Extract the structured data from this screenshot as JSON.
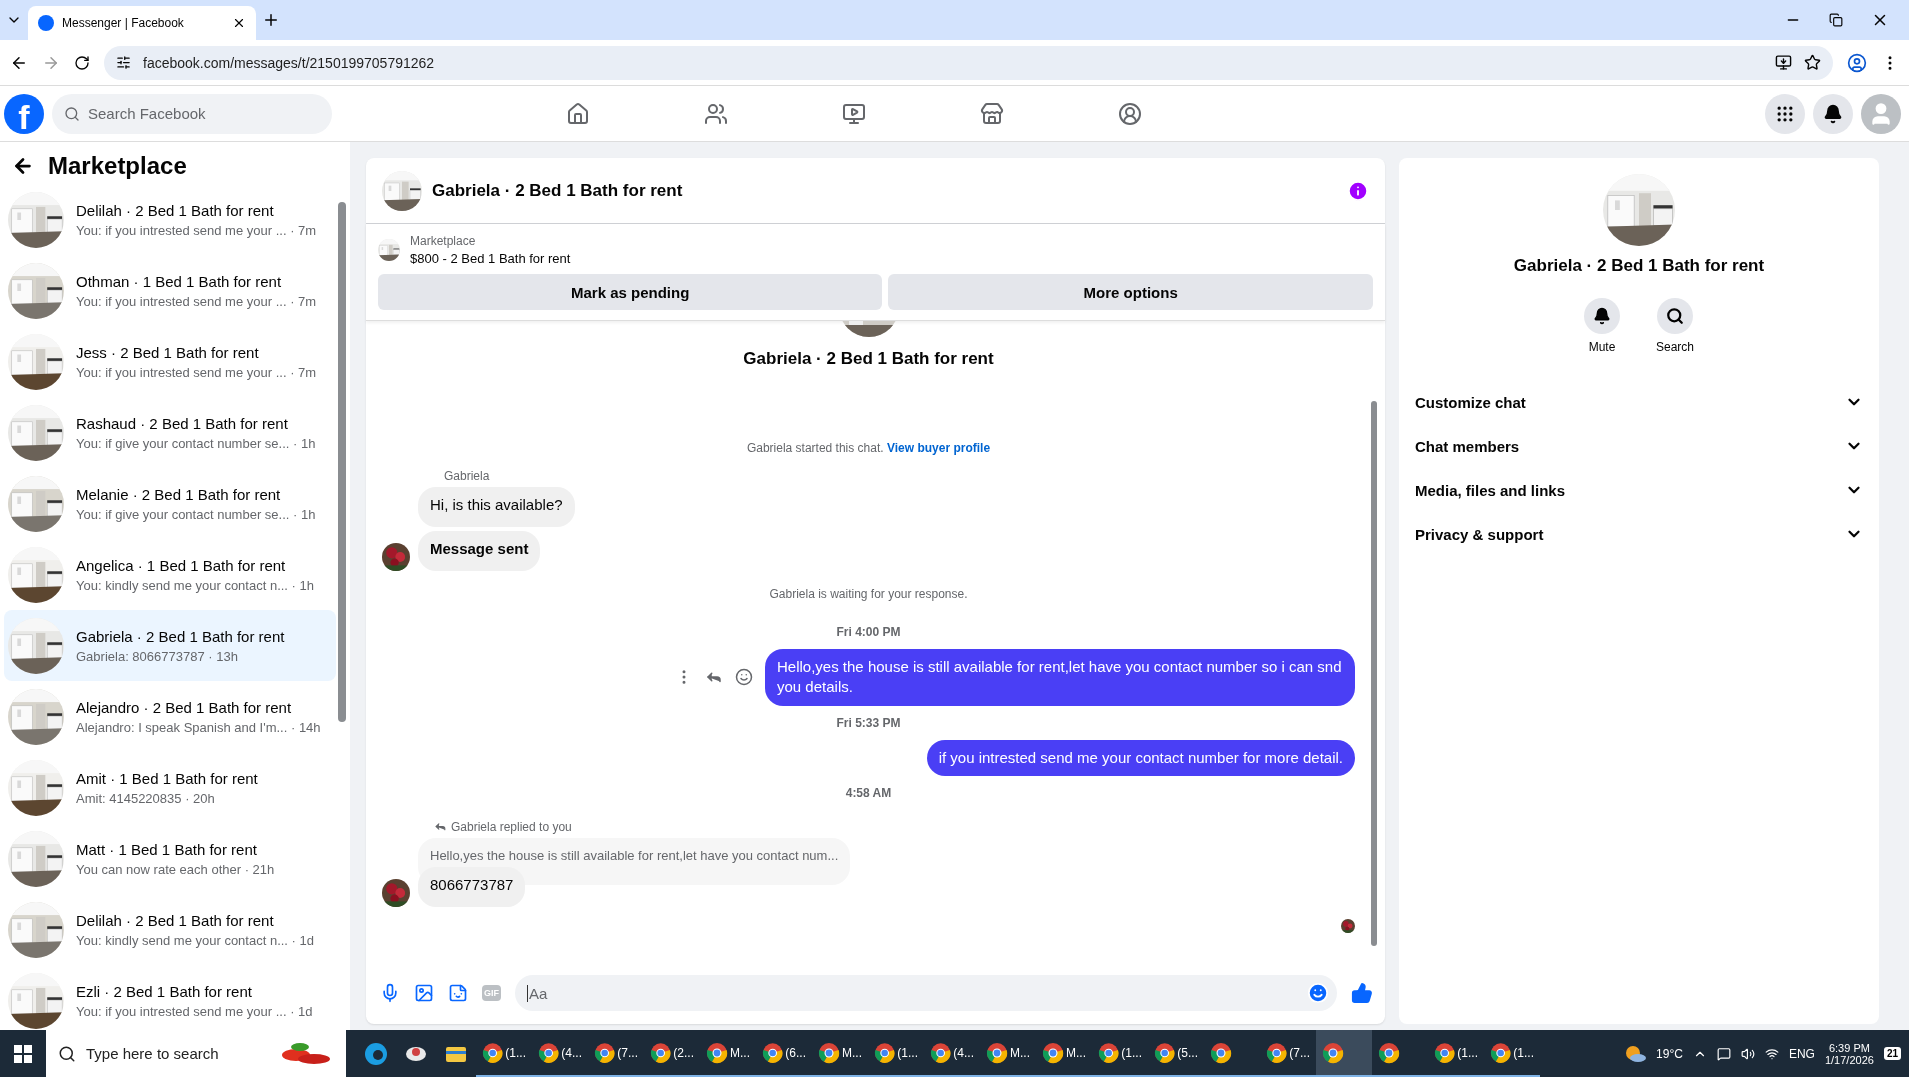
{
  "browser": {
    "tab_title": "Messenger | Facebook",
    "url": "facebook.com/messages/t/2150199705791262"
  },
  "facebook": {
    "logo_letter": "f",
    "search_placeholder": "Search Facebook"
  },
  "sidebar": {
    "title": "Marketplace",
    "conversations": [
      {
        "name": "Delilah · 2 Bed 1 Bath for rent",
        "preview": "You: if you intrested send me your ... · 7m",
        "selected": false
      },
      {
        "name": "Othman · 1 Bed 1 Bath for rent",
        "preview": "You: if you intrested send me your ... · 7m",
        "selected": false
      },
      {
        "name": "Jess · 2 Bed 1 Bath for rent",
        "preview": "You: if you intrested send me your ... · 7m",
        "selected": false
      },
      {
        "name": "Rashaud · 2 Bed 1 Bath for rent",
        "preview": "You: if give your contact number se... · 1h",
        "selected": false
      },
      {
        "name": "Melanie · 2 Bed 1 Bath for rent",
        "preview": "You: if give your contact number se... · 1h",
        "selected": false
      },
      {
        "name": "Angelica · 1 Bed 1 Bath for rent",
        "preview": "You: kindly send me your contact n... · 1h",
        "selected": false
      },
      {
        "name": "Gabriela · 2 Bed 1 Bath for rent",
        "preview": "Gabriela: 8066773787 · 13h",
        "selected": true
      },
      {
        "name": "Alejandro · 2 Bed 1 Bath for rent",
        "preview": "Alejandro: I speak Spanish and I'm... · 14h",
        "selected": false
      },
      {
        "name": "Amit · 1 Bed 1 Bath for rent",
        "preview": "Amit: 4145220835 · 20h",
        "selected": false
      },
      {
        "name": "Matt · 1 Bed 1 Bath for rent",
        "preview": "You can now rate each other · 21h",
        "selected": false
      },
      {
        "name": "Delilah · 2 Bed 1 Bath for rent",
        "preview": "You: kindly send me your contact n... · 1d",
        "selected": false
      },
      {
        "name": "Ezli · 2 Bed 1 Bath for rent",
        "preview": "You: if you intrested send me your ... · 1d",
        "selected": false
      }
    ]
  },
  "chat": {
    "title": "Gabriela · 2 Bed 1 Bath for rent",
    "listing": {
      "label": "Marketplace",
      "title": "$800 - 2 Bed 1 Bath for rent"
    },
    "actions": [
      "Mark as pending",
      "More options"
    ],
    "profile_name": "Gabriela · 2 Bed 1 Bath for rent",
    "messages": [
      {
        "kind": "system",
        "text": "Gabriela started this chat.",
        "link": "View buyer profile"
      },
      {
        "kind": "sender",
        "text": "Gabriela"
      },
      {
        "kind": "incoming",
        "text": "Hi, is this available?",
        "bold": false,
        "avatar": false
      },
      {
        "kind": "incoming",
        "text": "Message sent",
        "bold": true,
        "avatar": true
      },
      {
        "kind": "system",
        "text": "Gabriela is waiting for your response."
      },
      {
        "kind": "time",
        "text": "Fri 4:00 PM"
      },
      {
        "kind": "outgoing",
        "text": "Hello,yes the house is still available for rent,let have you contact number so i can snd you details.",
        "hover_actions": true
      },
      {
        "kind": "time",
        "text": "Fri 5:33 PM"
      },
      {
        "kind": "outgoing",
        "text": "if you intrested send me your contact number for more detail.",
        "hover_actions": false
      },
      {
        "kind": "time",
        "text": "4:58 AM"
      },
      {
        "kind": "reply",
        "label": "Gabriela replied to you",
        "quote": "Hello,yes the house is still available for rent,let have you contact num...",
        "text": "8066773787"
      }
    ],
    "composer": {
      "placeholder": "Aa",
      "gif_label": "GIF"
    }
  },
  "details": {
    "name": "Gabriela · 2 Bed 1 Bath for rent",
    "actions": [
      {
        "kind": "mute",
        "label": "Mute"
      },
      {
        "kind": "search",
        "label": "Search"
      }
    ],
    "sections": [
      "Customize chat",
      "Chat members",
      "Media, files and links",
      "Privacy & support"
    ]
  },
  "taskbar": {
    "search_placeholder": "Type here to search",
    "apps": [
      {
        "label": "(1...",
        "active": false
      },
      {
        "label": "(4...",
        "active": false
      },
      {
        "label": "(7...",
        "active": false
      },
      {
        "label": "(2...",
        "active": false
      },
      {
        "label": "M...",
        "active": false
      },
      {
        "label": "(6...",
        "active": false
      },
      {
        "label": "M...",
        "active": false
      },
      {
        "label": "(1...",
        "active": false
      },
      {
        "label": "(4...",
        "active": false
      },
      {
        "label": "M...",
        "active": false
      },
      {
        "label": "M...",
        "active": false
      },
      {
        "label": "(1...",
        "active": false
      },
      {
        "label": "(5...",
        "active": false
      },
      {
        "active": false
      },
      {
        "label": "(7...",
        "active": false
      },
      {
        "active": true
      },
      {
        "active": false
      },
      {
        "label": "(1...",
        "active": false
      },
      {
        "label": "(1...",
        "active": false
      }
    ],
    "weather": "19°C",
    "language": "ENG",
    "time": "6:39 PM",
    "date": "1/17/2026",
    "notifications": "21"
  }
}
